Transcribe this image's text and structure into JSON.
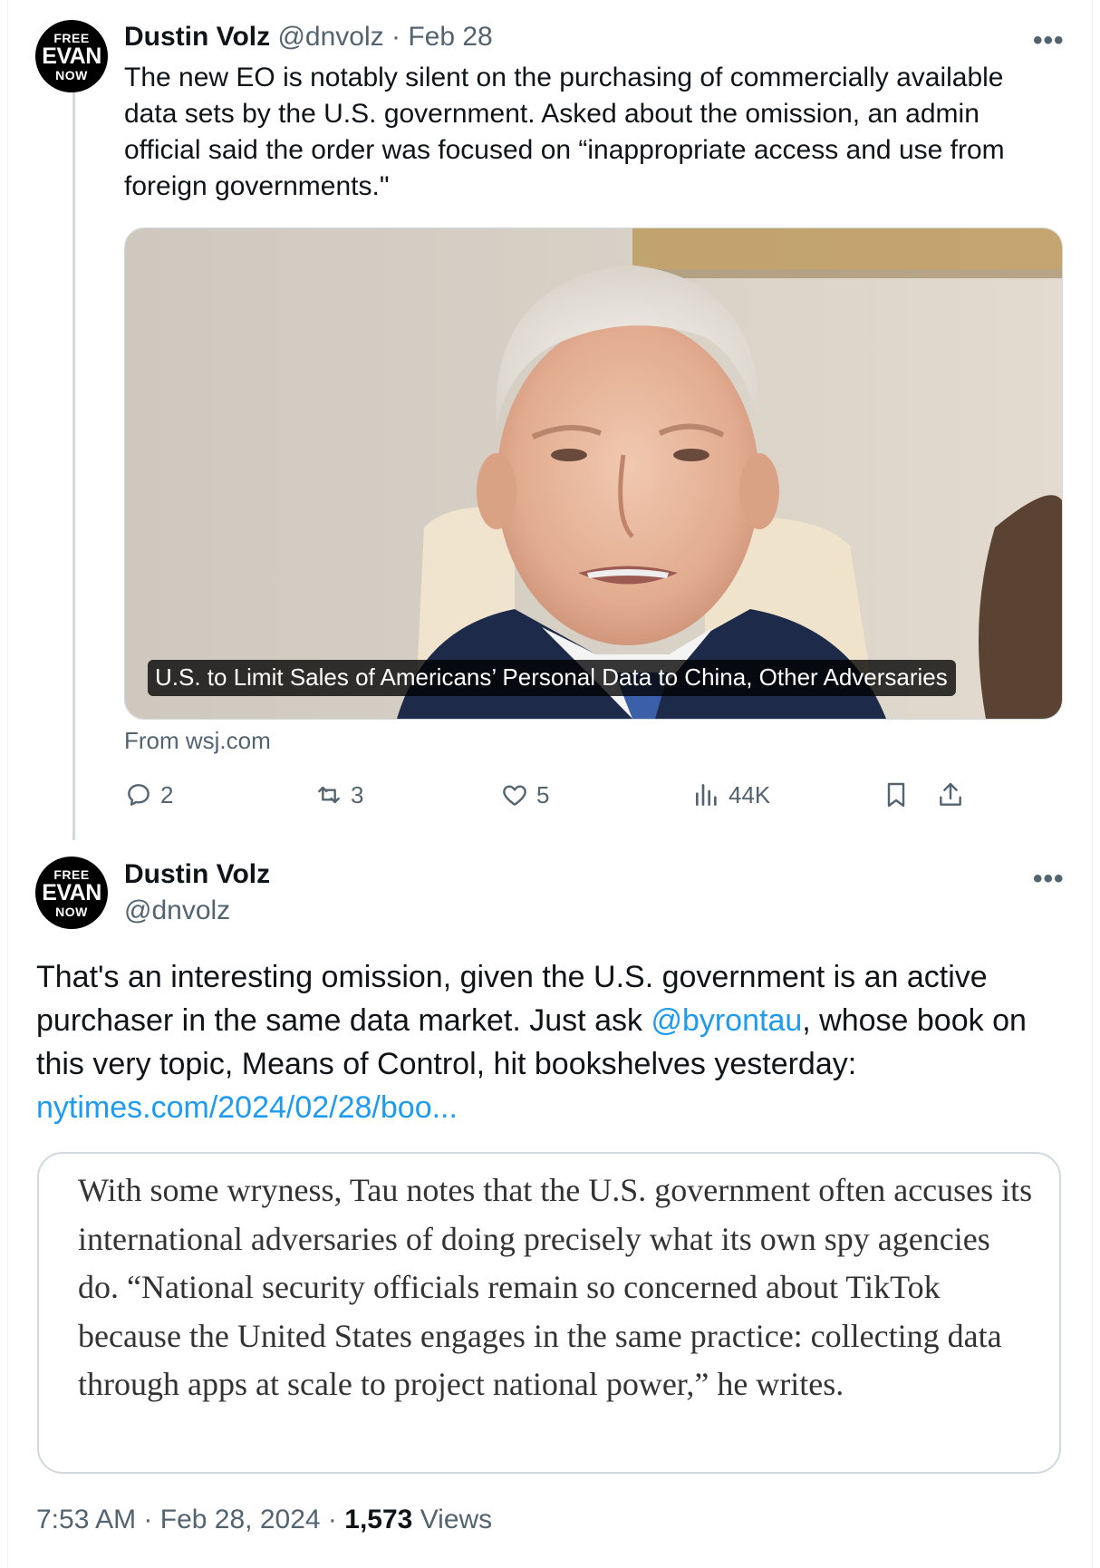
{
  "tweet1": {
    "avatar": {
      "line1": "FREE",
      "line2": "EVAN",
      "line3": "NOW"
    },
    "author_name": "Dustin Volz",
    "handle": "@dnvolz",
    "separator": "·",
    "date": "Feb 28",
    "text": "The new EO is notably silent on the purchasing of commercially available data sets by the U.S. government. Asked about the omission, an admin official said the order was focused on “inappropriate access and use from foreign governments.\"",
    "card": {
      "headline": "U.S. to Limit Sales of Americans’ Personal Data to China, Other Adversaries",
      "source": "From wsj.com"
    },
    "actions": {
      "replies": "2",
      "reposts": "3",
      "likes": "5",
      "views": "44K"
    }
  },
  "tweet2": {
    "avatar": {
      "line1": "FREE",
      "line2": "EVAN",
      "line3": "NOW"
    },
    "author_name": "Dustin Volz",
    "handle": "@dnvolz",
    "text_before_mention": "That's an interesting omission, given the U.S. government is an active purchaser in the same data market. Just ask ",
    "mention": "@byrontau",
    "text_after_mention": ", whose book on this very topic, Means of Control, hit bookshelves yesterday: ",
    "link": "nytimes.com/2024/02/28/boo...",
    "quote_image_text": "With some wryness, Tau notes that the U.S. government often accuses its international adversaries of doing precisely what its own spy agencies do. “National security officials remain so concerned about TikTok because the United States engages in the same practice: collecting data through apps at scale to project national power,” he writes.",
    "time": "7:53 AM",
    "date": "Feb 28, 2024",
    "sep": "·",
    "views_count": "1,573",
    "views_label": "Views"
  },
  "more_icon_glyph": "•••",
  "colors": {
    "link": "#1d9bf0",
    "muted": "#536471",
    "text": "#0f1419",
    "border": "#cfd9de"
  },
  "icons": [
    "avatar-logo",
    "more-icon",
    "reply-icon",
    "repost-icon",
    "like-icon",
    "views-icon",
    "bookmark-icon",
    "share-icon"
  ]
}
